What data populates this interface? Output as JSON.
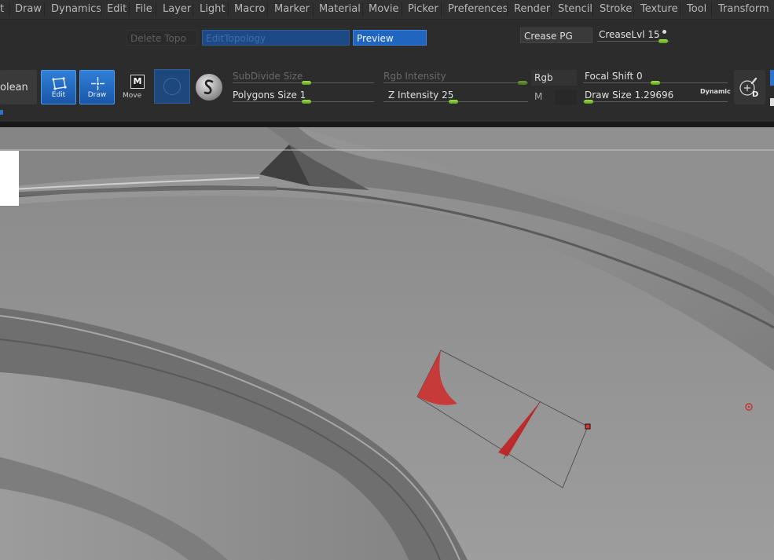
{
  "menu": [
    "t",
    "Draw",
    "Dynamics",
    "Edit",
    "File",
    "Layer",
    "Light",
    "Macro",
    "Marker",
    "Material",
    "Movie",
    "Picker",
    "Preferences",
    "Render",
    "Stencil",
    "Stroke",
    "Texture",
    "Tool",
    "Transform"
  ],
  "topology": {
    "delete_topo": "Delete Topo",
    "edit_topology": "EditTopology",
    "preview": "Preview",
    "crease_pg": "Crease PG",
    "crease_lvl": "CreaseLvl 15"
  },
  "toolbar": {
    "boolean_label": "olean",
    "edit_label": "Edit",
    "draw_label": "Draw",
    "move_label": "Move",
    "move_badge": "M",
    "subdivide_size": "SubDivide Size",
    "polygons_size": "Polygons Size 1",
    "rgb_intensity": "Rgb Intensity",
    "z_intensity": "Z Intensity 25",
    "rgb": "Rgb",
    "m": "M",
    "focal_shift": "Focal Shift 0",
    "draw_size": "Draw Size 1.29696",
    "dynamic": "Dynamic",
    "d_badge": "D"
  },
  "colors": {
    "accent_blue": "#2a74cf",
    "slider_green": "#7cc536",
    "mask_red": "#d02a2a"
  },
  "icons": [
    "edit-mode-icon",
    "draw-mode-icon",
    "move-mode-icon",
    "material-sphere-icon",
    "stroke-icon",
    "brush-d-icon"
  ]
}
